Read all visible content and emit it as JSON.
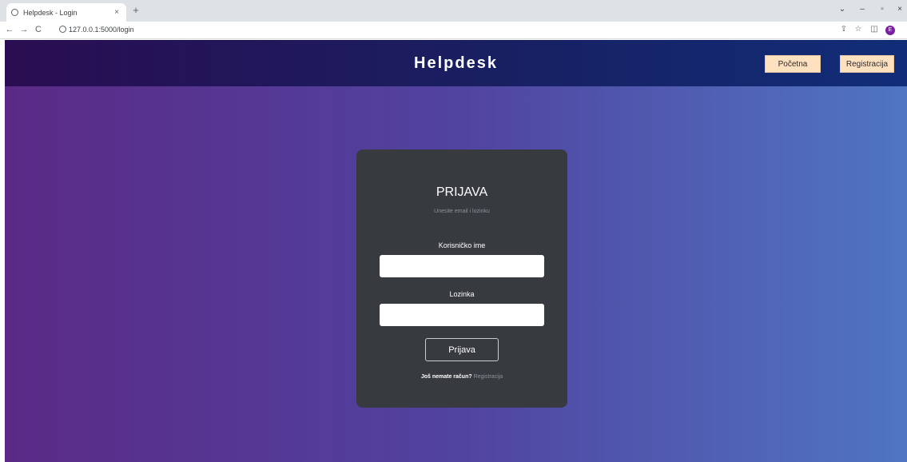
{
  "browser": {
    "tab_title": "Helpdesk - Login",
    "tab_close": "×",
    "new_tab": "+",
    "url": "127.0.0.1:5000/login",
    "nav": {
      "back": "←",
      "forward": "→",
      "reload": "C"
    },
    "window": {
      "dropdown": "⌄",
      "minimize": "–",
      "maximize": "▫",
      "close": "×"
    },
    "icons": {
      "share": "⇪",
      "star": "☆",
      "sidepanel": "◫",
      "profile": "E"
    }
  },
  "app": {
    "brand": "Helpdesk",
    "nav": {
      "home": "Početna",
      "register": "Registracija"
    },
    "login": {
      "title": "PRIJAVA",
      "subtitle": "Unesite email i lozinku",
      "username_label": "Korisničko ime",
      "username_value": "",
      "password_label": "Lozinka",
      "password_value": "",
      "submit": "Prijava",
      "footer_question": "Još nemate račun?",
      "footer_link": "Registracija"
    }
  },
  "colors": {
    "accent_button": "#ffe1bf",
    "card": "#373a3e",
    "navbar": "#182062"
  }
}
